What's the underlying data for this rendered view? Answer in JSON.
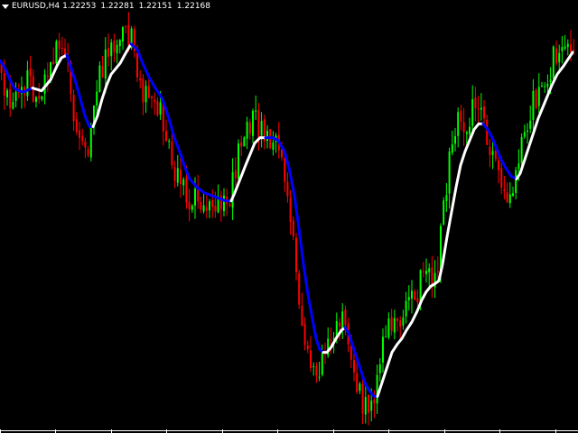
{
  "header": {
    "symbol_timeframe": "EURUSD,H4",
    "open": "1.22253",
    "high": "1.22281",
    "low": "1.22151",
    "close": "1.22168"
  },
  "colors": {
    "background": "#000000",
    "bull_candle": "#00ff00",
    "bear_candle": "#ff0000",
    "line_falling": "#0000ff",
    "line_rising": "#ffffff",
    "axis": "#ffffff"
  },
  "chart_data": {
    "type": "line",
    "chart_style": "candlestick-with-smoothed-trend-line",
    "series": [
      {
        "kind": "smoothed-trend",
        "points": [
          [
            0,
            1.2254
          ],
          [
            6,
            1.2251
          ],
          [
            11,
            1.2247
          ],
          [
            16,
            1.2244
          ],
          [
            21,
            1.2243
          ],
          [
            26,
            1.22425
          ],
          [
            32,
            1.22435
          ],
          [
            36,
            1.2244
          ],
          [
            46,
            1.2243
          ],
          [
            56,
            1.2247
          ],
          [
            63,
            1.2252
          ],
          [
            68,
            1.2255
          ],
          [
            74,
            1.2256
          ],
          [
            78,
            1.2252
          ],
          [
            83,
            1.2247
          ],
          [
            89,
            1.224
          ],
          [
            94,
            1.2234
          ],
          [
            99,
            1.223
          ],
          [
            103,
            1.223
          ],
          [
            108,
            1.2234
          ],
          [
            113,
            1.224
          ],
          [
            118,
            1.2245
          ],
          [
            123,
            1.2249
          ],
          [
            128,
            1.2251
          ],
          [
            133,
            1.2253
          ],
          [
            138,
            1.2256
          ],
          [
            145,
            1.226
          ],
          [
            152,
            1.2258
          ],
          [
            158,
            1.2253
          ],
          [
            165,
            1.2248
          ],
          [
            172,
            1.2244
          ],
          [
            180,
            1.224
          ],
          [
            187,
            1.2233
          ],
          [
            193,
            1.2226
          ],
          [
            200,
            1.222
          ],
          [
            205,
            1.2215
          ],
          [
            210,
            1.2211
          ],
          [
            218,
            1.2208
          ],
          [
            226,
            1.2206
          ],
          [
            234,
            1.2205
          ],
          [
            242,
            1.2204
          ],
          [
            250,
            1.2203
          ],
          [
            256,
            1.2203
          ],
          [
            260,
            1.2206
          ],
          [
            266,
            1.2211
          ],
          [
            272,
            1.2216
          ],
          [
            277,
            1.222
          ],
          [
            282,
            1.2224
          ],
          [
            288,
            1.2226
          ],
          [
            294,
            1.2226
          ],
          [
            302,
            1.2226
          ],
          [
            308,
            1.2225
          ],
          [
            315,
            1.2221
          ],
          [
            320,
            1.2215
          ],
          [
            326,
            1.2205
          ],
          [
            331,
            1.2193
          ],
          [
            336,
            1.218
          ],
          [
            341,
            1.2169
          ],
          [
            346,
            1.216
          ],
          [
            350,
            1.2153
          ],
          [
            354,
            1.2149
          ],
          [
            358,
            1.2148
          ],
          [
            362,
            1.2148
          ],
          [
            367,
            1.215
          ],
          [
            372,
            1.2153
          ],
          [
            378,
            1.2156
          ],
          [
            382,
            1.2157
          ],
          [
            386,
            1.2155
          ],
          [
            390,
            1.2151
          ],
          [
            394,
            1.2147
          ],
          [
            399,
            1.2142
          ],
          [
            404,
            1.2137
          ],
          [
            409,
            1.2134
          ],
          [
            414,
            1.2132
          ],
          [
            418,
            1.2132
          ],
          [
            422,
            1.2136
          ],
          [
            428,
            1.2142
          ],
          [
            434,
            1.2148
          ],
          [
            440,
            1.2151
          ],
          [
            445,
            1.2153
          ],
          [
            450,
            1.2156
          ],
          [
            456,
            1.2159
          ],
          [
            462,
            1.2163
          ],
          [
            467,
            1.2167
          ],
          [
            472,
            1.217
          ],
          [
            477,
            1.2172
          ],
          [
            482,
            1.2173
          ],
          [
            486,
            1.2174
          ],
          [
            490,
            1.218
          ],
          [
            495,
            1.219
          ],
          [
            500,
            1.2199
          ],
          [
            505,
            1.2208
          ],
          [
            510,
            1.2216
          ],
          [
            515,
            1.2221
          ],
          [
            520,
            1.2225
          ],
          [
            525,
            1.2229
          ],
          [
            530,
            1.2231
          ],
          [
            535,
            1.2231
          ],
          [
            540,
            1.2229
          ],
          [
            545,
            1.2226
          ],
          [
            550,
            1.2222
          ],
          [
            555,
            1.2218
          ],
          [
            560,
            1.2215
          ],
          [
            566,
            1.2212
          ],
          [
            572,
            1.2211
          ],
          [
            576,
            1.2213
          ],
          [
            581,
            1.2218
          ],
          [
            586,
            1.2223
          ],
          [
            591,
            1.2228
          ],
          [
            596,
            1.2233
          ],
          [
            601,
            1.2237
          ],
          [
            606,
            1.2241
          ],
          [
            611,
            1.2245
          ],
          [
            617,
            1.2249
          ],
          [
            624,
            1.2252
          ],
          [
            630,
            1.2255
          ],
          [
            634,
            1.2257
          ]
        ],
        "turning_points": [
          36,
          63,
          74,
          103,
          145,
          256,
          294,
          358,
          382,
          418,
          535,
          572
        ]
      }
    ],
    "ylim": [
      1.212,
      1.2276
    ],
    "grid": false,
    "legend": "none"
  }
}
